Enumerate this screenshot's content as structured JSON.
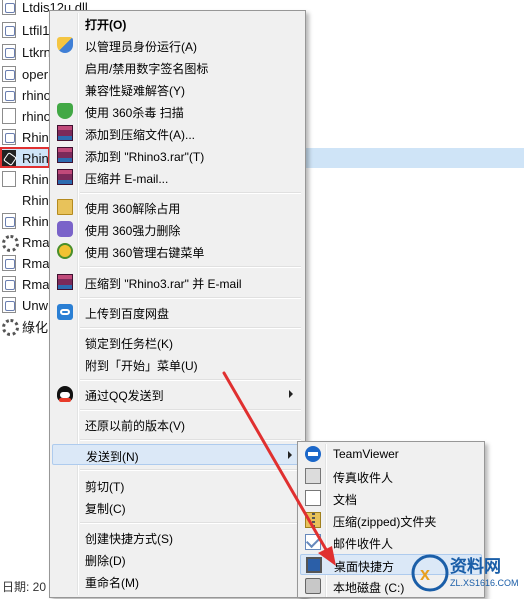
{
  "explorer": {
    "files": [
      {
        "name": "Ltdis12u.dll",
        "icon": "dll-file-icon"
      },
      {
        "name": "Ltfil1",
        "icon": "dll-file-icon"
      },
      {
        "name": "Ltkrn",
        "icon": "dll-file-icon"
      },
      {
        "name": "oper",
        "icon": "dll-file-icon"
      },
      {
        "name": "rhino",
        "icon": "dll-file-icon"
      },
      {
        "name": "rhino",
        "icon": "blank-file-icon"
      },
      {
        "name": "Rhin",
        "icon": "dll-file-icon"
      },
      {
        "name": "Rhin",
        "icon": "rhino-app-icon"
      },
      {
        "name": "Rhin",
        "icon": "blank-file-icon"
      },
      {
        "name": "Rhin",
        "icon": "none"
      },
      {
        "name": "Rhin",
        "icon": "dll-file-icon"
      },
      {
        "name": "Rma",
        "icon": "gear-file-icon"
      },
      {
        "name": "Rma",
        "icon": "dll-file-icon"
      },
      {
        "name": "Rma",
        "icon": "dll-file-icon"
      },
      {
        "name": "Unw",
        "icon": "dll-file-icon"
      },
      {
        "name": "綠化",
        "icon": "gear-file-icon"
      }
    ],
    "status_date": "日期: 20"
  },
  "context_menu": {
    "items": [
      {
        "label": "打开(O)",
        "icon": "none",
        "bold": true
      },
      {
        "label": "以管理员身份运行(A)",
        "icon": "uac-shield-icon"
      },
      {
        "label": "启用/禁用数字签名图标",
        "icon": "none"
      },
      {
        "label": "兼容性疑难解答(Y)",
        "icon": "none"
      },
      {
        "label": "使用 360杀毒 扫描",
        "icon": "360-antivirus-icon"
      },
      {
        "label": "添加到压缩文件(A)...",
        "icon": "winrar-icon"
      },
      {
        "label": "添加到 \"Rhino3.rar\"(T)",
        "icon": "winrar-icon"
      },
      {
        "label": "压缩并 E-mail...",
        "icon": "winrar-icon"
      },
      {
        "label": "使用 360解除占用",
        "icon": "360-unlock-icon"
      },
      {
        "label": "使用 360强力删除",
        "icon": "360-delete-icon"
      },
      {
        "label": "使用 360管理右键菜单",
        "icon": "360-manage-icon"
      },
      {
        "label": "压缩到 \"Rhino3.rar\" 并 E-mail",
        "icon": "winrar-icon"
      },
      {
        "label": "上传到百度网盘",
        "icon": "baidu-cloud-icon"
      },
      {
        "label": "锁定到任务栏(K)",
        "icon": "none"
      },
      {
        "label": "附到「开始」菜单(U)",
        "icon": "none"
      },
      {
        "label": "通过QQ发送到",
        "icon": "qq-icon",
        "submenu": true
      },
      {
        "label": "还原以前的版本(V)",
        "icon": "none"
      },
      {
        "label": "发送到(N)",
        "icon": "none",
        "submenu": true,
        "highlighted": true
      },
      {
        "label": "剪切(T)",
        "icon": "none"
      },
      {
        "label": "复制(C)",
        "icon": "none"
      },
      {
        "label": "创建快捷方式(S)",
        "icon": "none"
      },
      {
        "label": "删除(D)",
        "icon": "none"
      },
      {
        "label": "重命名(M)",
        "icon": "none"
      }
    ]
  },
  "send_to_menu": {
    "items": [
      {
        "label": "TeamViewer",
        "icon": "teamviewer-icon"
      },
      {
        "label": "传真收件人",
        "icon": "fax-icon"
      },
      {
        "label": "文档",
        "icon": "documents-icon"
      },
      {
        "label": "压缩(zipped)文件夹",
        "icon": "zip-folder-icon"
      },
      {
        "label": "邮件收件人",
        "icon": "mail-recipient-icon"
      },
      {
        "label": "桌面快捷方",
        "icon": "desktop-shortcut-icon",
        "highlighted": true
      },
      {
        "label": "本地磁盘 (C:)",
        "icon": "local-disk-icon"
      }
    ]
  },
  "watermark": {
    "main": "资料网",
    "sub": "ZL.XS1616.COM"
  },
  "colors": {
    "selection": "#cfe4f7",
    "menu_bg": "#f0f0f0",
    "highlight": "#dbe8f7",
    "annotation_red": "#e03030"
  }
}
